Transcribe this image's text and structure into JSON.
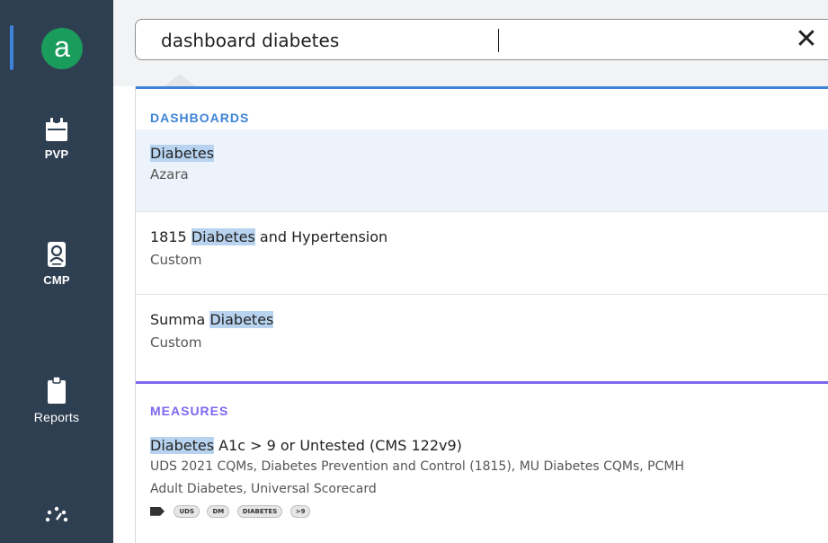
{
  "sidebar": {
    "logo_letter": "a",
    "items": [
      {
        "label": "PVP",
        "icon": "calendar-icon"
      },
      {
        "label": "CMP",
        "icon": "patient-id-icon"
      },
      {
        "label": "Reports",
        "icon": "clipboard-icon"
      },
      {
        "label": "",
        "icon": "dashboard-gauge-icon"
      }
    ]
  },
  "search": {
    "value": "dashboard diabetes",
    "clear_icon": "close-icon",
    "clear_glyph": "✕"
  },
  "sections": {
    "dashboards": {
      "heading": "DASHBOARDS",
      "color": "#3d83d6",
      "items": [
        {
          "pre": "",
          "highlight": "Diabetes",
          "post": "",
          "subtitle": "Azara"
        },
        {
          "pre": "1815 ",
          "highlight": "Diabetes",
          "post": " and Hypertension",
          "subtitle": "Custom"
        },
        {
          "pre": "Summa ",
          "highlight": "Diabetes",
          "post": "",
          "subtitle": "Custom"
        }
      ]
    },
    "measures": {
      "heading": "MEASURES",
      "color": "#7b68ee",
      "items": [
        {
          "pre": "",
          "highlight": "Diabetes",
          "post": " A1c > 9 or Untested (CMS 122v9)",
          "subtitle_line1": "UDS 2021 CQMs, Diabetes Prevention and Control (1815), MU Diabetes CQMs, PCMH",
          "subtitle_line2": "Adult Diabetes, Universal Scorecard",
          "tag_icon": "tag-icon",
          "tags": [
            "UDS",
            "DM",
            "DIABETES",
            ">9"
          ]
        }
      ]
    }
  },
  "colors": {
    "sidebar_bg": "#2f3f52",
    "logo_bg": "#1a9c5c",
    "highlight": "#b8d3ef",
    "selected_row": "#edf3fa"
  }
}
